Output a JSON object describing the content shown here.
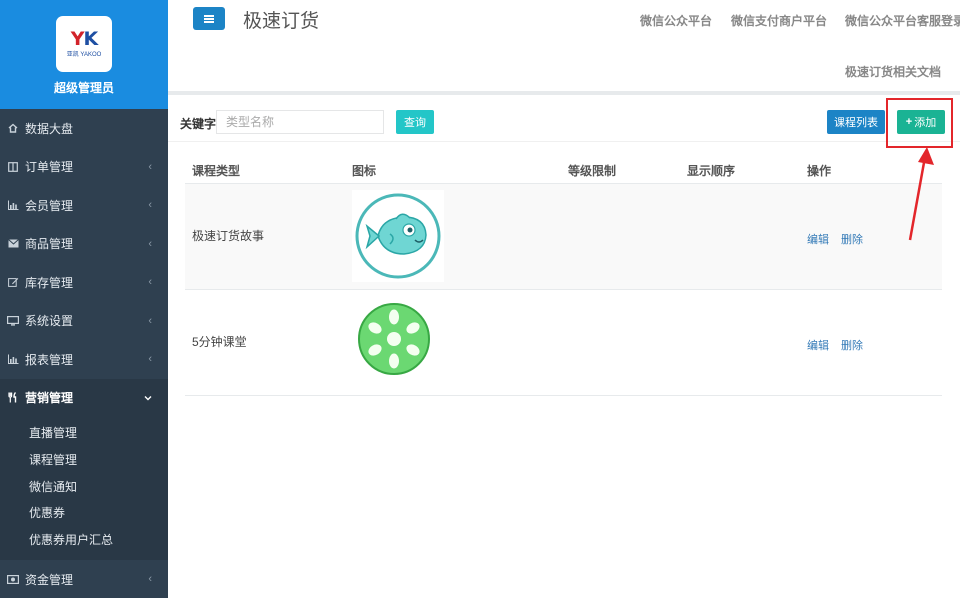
{
  "sidebar": {
    "logo_mark": "YK",
    "logo_text": "亚凯 YAKOO",
    "user_role": "超级管理员",
    "menu": [
      {
        "label": "数据大盘",
        "icon": "home-icon",
        "has_chevron": false
      },
      {
        "label": "订单管理",
        "icon": "columns-icon",
        "has_chevron": true
      },
      {
        "label": "会员管理",
        "icon": "bar-chart-icon",
        "has_chevron": true
      },
      {
        "label": "商品管理",
        "icon": "envelope-icon",
        "has_chevron": true
      },
      {
        "label": "库存管理",
        "icon": "edit-icon",
        "has_chevron": true
      },
      {
        "label": "系统设置",
        "icon": "desktop-icon",
        "has_chevron": true
      },
      {
        "label": "报表管理",
        "icon": "bar-chart-icon",
        "has_chevron": true
      },
      {
        "label": "营销管理",
        "icon": "cutlery-icon",
        "has_chevron": true,
        "active": true
      },
      {
        "label": "资金管理",
        "icon": "money-icon",
        "has_chevron": true
      }
    ],
    "submenu": [
      "直播管理",
      "课程管理",
      "微信通知",
      "优惠券",
      "优惠券用户汇总"
    ]
  },
  "topbar": {
    "title": "极速订货",
    "links": [
      "微信公众平台",
      "微信支付商户平台",
      "微信公众平台客服登录",
      "极速订货相关文档"
    ]
  },
  "search": {
    "label": "关键字",
    "placeholder": "类型名称",
    "query_button": "查询"
  },
  "actions": {
    "list_button": "课程列表",
    "add_button": "添加"
  },
  "table": {
    "headers": [
      "课程类型",
      "图标",
      "等级限制",
      "显示顺序",
      "操作"
    ],
    "rows": [
      {
        "name": "极速订货故事",
        "icon": "fish-icon",
        "level": "",
        "order": "",
        "edit": "编辑",
        "delete": "删除"
      },
      {
        "name": "5分钟课堂",
        "icon": "lotus-root-icon",
        "level": "",
        "order": "",
        "edit": "编辑",
        "delete": "删除"
      }
    ]
  },
  "colors": {
    "sidebar_bg": "#2f4050",
    "header_blue": "#1a8ce0",
    "primary": "#1c84c6",
    "info": "#23c6c8",
    "success": "#1ab394",
    "annotation_red": "#e3262b"
  }
}
